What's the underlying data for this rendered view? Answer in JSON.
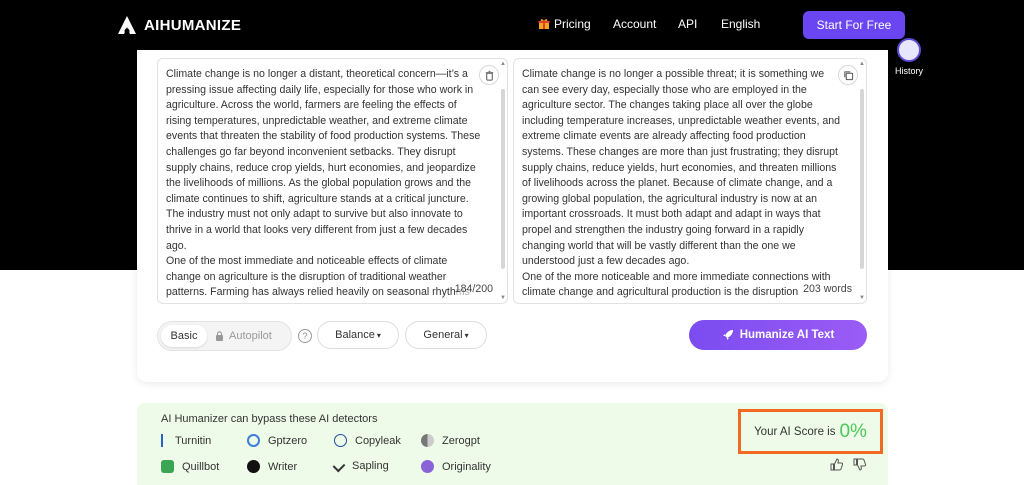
{
  "brand": {
    "name": "AIHUMANIZE"
  },
  "nav": {
    "pricing": "Pricing",
    "account": "Account",
    "api": "API",
    "language": "English",
    "cta": "Start For Free"
  },
  "sidebar": {
    "history_label": "History"
  },
  "input_panel": {
    "paragraphs": [
      "Climate change is no longer a distant, theoretical concern—it’s a pressing issue affecting daily life, especially for those who work in agriculture. Across the world, farmers are feeling the effects of rising temperatures, unpredictable weather, and extreme climate events that threaten the stability of food production systems. These challenges go far beyond inconvenient setbacks. They disrupt supply chains, reduce crop yields, hurt economies, and jeopardize the livelihoods of millions. As the global population grows and the climate continues to shift, agriculture stands at a critical juncture. The industry must not only adapt to survive but also innovate to thrive in a world that looks very different from just a few decades ago.",
      "One of the most immediate and noticeable effects of climate change on agriculture is the disruption of traditional weather patterns. Farming has always relied heavily on seasonal rhythms"
    ],
    "count": "184/200"
  },
  "output_panel": {
    "paragraphs": [
      "Climate change is no longer a possible threat; it is something we can see every day, especially those who are employed in the agriculture sector. The changes taking place all over the globe including temperature increases, unpredictable weather events, and extreme climate events are already affecting food production systems. These changes are more than just frustrating; they disrupt supply chains, reduce yields, hurt economies, and threaten millions of livelihoods across the planet. Because of climate change, and a growing global population, the agricultural industry is now at an important crossroads. It must both adapt and adapt in ways that propel and strengthen the industry going forward in a rapidly changing world that will be vastly different than the one we understood just a few decades ago.",
      "One of the more noticeable and more immediate connections with climate change and agricultural production is the disruption"
    ],
    "count": "203 words"
  },
  "controls": {
    "mode_basic": "Basic",
    "mode_autopilot": "Autopilot",
    "help": "?",
    "dropdown_balance": "Balance",
    "dropdown_general": "General",
    "humanize_button": "Humanize AI Text"
  },
  "detectors": {
    "title": "AI Humanizer can bypass these AI detectors",
    "items": [
      {
        "name": "Turnitin",
        "color": "#2a63c7"
      },
      {
        "name": "Gptzero",
        "color": "#3f7fd8"
      },
      {
        "name": "Copyleak",
        "color": "#1f4c9c"
      },
      {
        "name": "Zerogpt",
        "color": "#777777"
      },
      {
        "name": "Quillbot",
        "color": "#3aa655"
      },
      {
        "name": "Writer",
        "color": "#111111"
      },
      {
        "name": "Sapling",
        "color": "#333333"
      },
      {
        "name": "Originality",
        "color": "#8a63d8"
      }
    ]
  },
  "score": {
    "label": "Your AI Score is",
    "value": "0%"
  },
  "colors": {
    "accent": "#6a46f2",
    "score_green": "#4cc75a",
    "highlight_box": "#f26a21",
    "detector_bg": "#eefbe8"
  }
}
